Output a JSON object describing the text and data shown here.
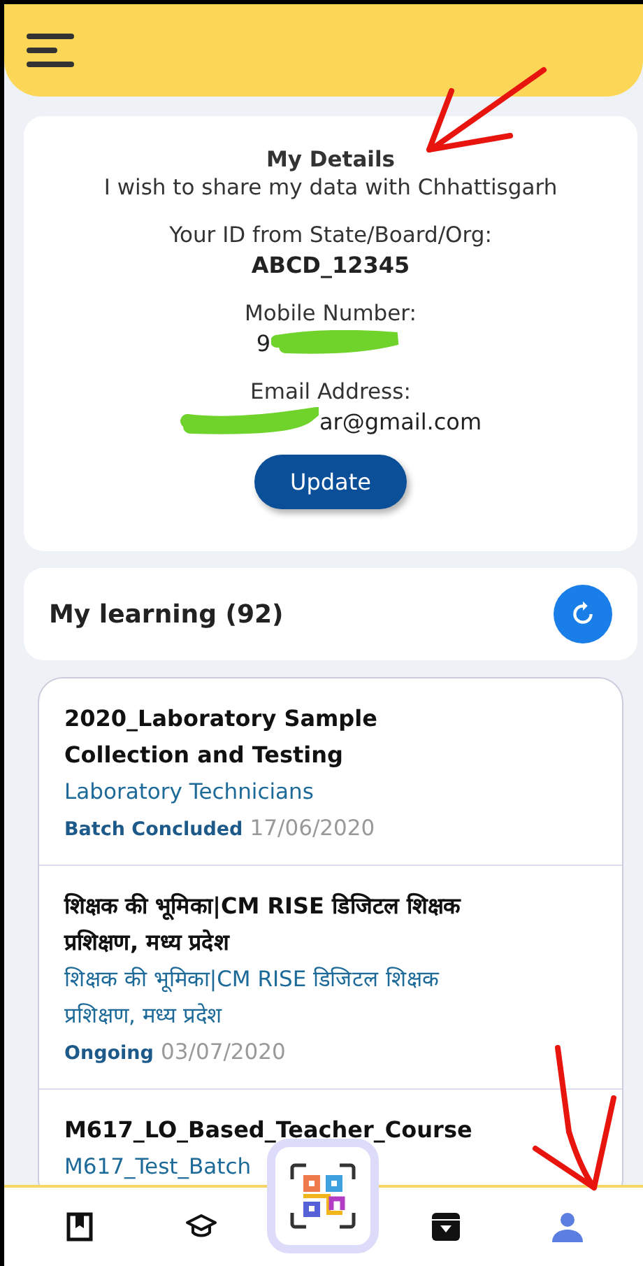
{
  "details": {
    "title": "My Details",
    "consent": "I wish to share my data with Chhattisgarh",
    "fields": [
      {
        "label": "Your ID from State/Board/Org:",
        "value": "ABCD_12345",
        "redacted": false
      },
      {
        "label": "Mobile Number:",
        "value": "9",
        "redacted": true
      },
      {
        "label": "Email Address:",
        "value": "ar@gmail.com",
        "redacted": true
      }
    ],
    "button": "Update"
  },
  "learning": {
    "title": "My learning (92)"
  },
  "courses": [
    {
      "title": "2020_Laboratory Sample Collection and Testing",
      "batch": "Laboratory Technicians",
      "status": "Batch Concluded",
      "date": "17/06/2020"
    },
    {
      "title": "शिक्षक की भूमिका|CM RISE डिजिटल शिक्षक प्रशिक्षण, मध्य प्रदेश",
      "batch": "शिक्षक की भूमिका|CM RISE डिजिटल शिक्षक प्रशिक्षण, मध्य प्रदेश",
      "status": "Ongoing",
      "date": "03/07/2020"
    },
    {
      "title": "M617_LO_Based_Teacher_Course",
      "batch": "M617_Test_Batch"
    }
  ],
  "nav": [
    {
      "kind": "bookmark",
      "selected": false
    },
    {
      "kind": "courses",
      "selected": false
    },
    {
      "kind": "scan",
      "selected": false
    },
    {
      "kind": "downloads",
      "selected": false
    },
    {
      "kind": "profile",
      "selected": true
    }
  ]
}
